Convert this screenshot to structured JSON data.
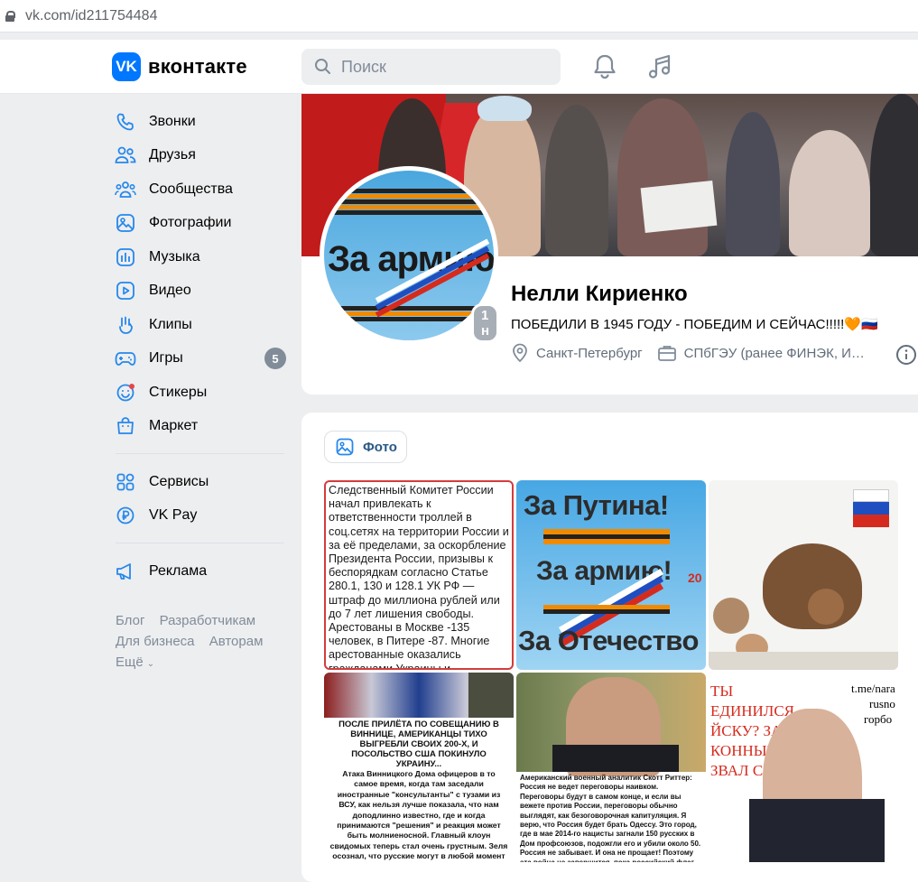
{
  "browser": {
    "url": "vk.com/id211754484"
  },
  "header": {
    "logo_text": "вконтакте",
    "logo_mark": "VK",
    "search_placeholder": "Поиск"
  },
  "sidebar": {
    "items": [
      {
        "label": "Звонки",
        "icon": "phone-icon"
      },
      {
        "label": "Друзья",
        "icon": "friends-icon"
      },
      {
        "label": "Сообщества",
        "icon": "communities-icon"
      },
      {
        "label": "Фотографии",
        "icon": "photos-icon"
      },
      {
        "label": "Музыка",
        "icon": "music-icon"
      },
      {
        "label": "Видео",
        "icon": "video-icon"
      },
      {
        "label": "Клипы",
        "icon": "clips-icon"
      },
      {
        "label": "Игры",
        "icon": "games-icon",
        "badge": "5"
      },
      {
        "label": "Стикеры",
        "icon": "stickers-icon"
      },
      {
        "label": "Маркет",
        "icon": "market-icon"
      }
    ],
    "items2": [
      {
        "label": "Сервисы",
        "icon": "services-icon"
      },
      {
        "label": "VK Pay",
        "icon": "vkpay-icon"
      }
    ],
    "items3": [
      {
        "label": "Реклама",
        "icon": "ads-icon"
      }
    ],
    "footer": {
      "blog": "Блог",
      "developers": "Разработчикам",
      "business": "Для бизнеса",
      "authors": "Авторам",
      "more": "Ещё"
    }
  },
  "profile": {
    "name": "Нелли Кириенко",
    "status": "ПОБЕДИЛИ В 1945 ГОДУ - ПОБЕДИМ И СЕЙЧАС!!!!!🧡🇷🇺",
    "city": "Санкт-Петербург",
    "education": "СПбГЭУ (ранее ФИНЭК, И…",
    "online_badge": "1 н",
    "avatar_text": "За армию"
  },
  "photos": {
    "button_label": "Фото",
    "tile1_text": "Следственный Комитет России начал привлекать к ответственности троллей в соц.сетях на территории России и за её пределами, за оскорбление Президента России, призывы к беспорядкам согласно Статье 280.1, 130 и 128.1 УК РФ — штраф до миллиона рублей или до 7 лет лишения свободы. Арестованы в Москве -135 человек, в Питере -87. Многие арестованные оказались гражданами Украины и Прибалтики. Процесс пошел.",
    "tile2_line1": "За Путина!",
    "tile2_line2": "За армию!",
    "tile2_line3": "За Отечество",
    "tile2_year": "20",
    "tile4_title": "ПОСЛЕ ПРИЛЁТА ПО СОВЕЩАНИЮ В ВИННИЦЕ, АМЕРИКАНЦЫ ТИХО ВЫГРЕБЛИ СВОИХ 200-Х, И ПОСОЛЬСТВО США ПОКИНУЛО УКРАИНУ...",
    "tile4_body": "Атака Винницкого Дома офицеров в то самое время, когда там заседали иностранные \"консультанты\" с тузами из ВСУ, как нельзя лучше показала, что нам доподлинно известно, где и когда принимаются \"решения\" и реакция может быть молниеносной. Главный клоун свидомых теперь стал очень грустным. Зеля осознал, что русские могут в любой момент отправить в гости к Бандере каждого из них. Если только захотят... Вот и реакция США по этому поводу... Ни каких тебе воплей, ни пресс-конференций, ни претензий. Они всё поняли. С полуслова. Поэтому",
    "tile5_text": "Американский военный аналитик Скотт Риттер: Россия не ведет переговоры наивком. Переговоры будут в самом конце, и если вы вежете против России, переговоры обычно выглядят, как безоговорочная капитуляция. Я верю, что Россия будет брать Одессу. Это город, где в мае 2014-го нацисты загнали 150 русских в Дом профсоюзов, подожгли его и убили около 50. Россия не забывает. И она не прощает! Поэтому эта война не завершится, пока российский флаг не будет развеваться над Одессой. Украина заплатит свою цену! Я знаю русских, они не будут ждать на пушинку. Но за закрытыми дверями русские жорики прохрипят: «Одесса!» И Путин ответит: «Хорошо! Я вас услышал». Это все не завершится без Одессы в составе России.",
    "tile6_left": "ТЫ ЕДИНИЛСЯ ЙСКУ? ЗА КОННЫЙ ЗВАЛ ССР",
    "tile6_right1": "t.me/nara",
    "tile6_right2": "rusno",
    "tile6_right3": "горбо"
  },
  "colors": {
    "accent": "#0077ff",
    "link": "#2a5885",
    "bg": "#edeef0"
  }
}
